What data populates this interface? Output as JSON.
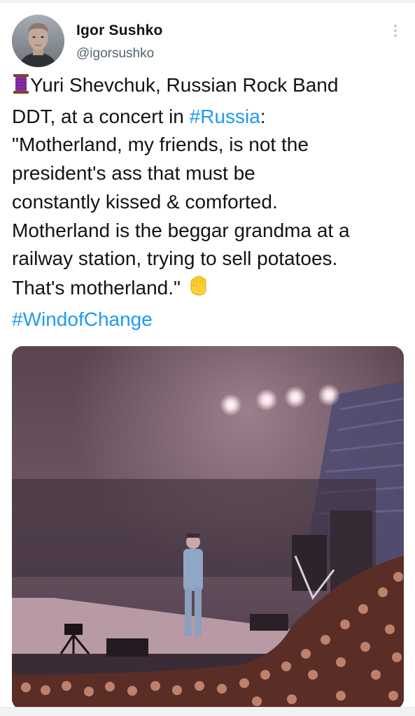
{
  "tweet": {
    "author": {
      "display_name": "Igor Sushko",
      "handle": "@igorsushko",
      "avatar_icon": "profile-photo"
    },
    "more_icon": "more-vertical-icon",
    "text_lines": [
      {
        "pre": "Yuri Shevchuk, Russian Rock Band",
        "emoji": "thread-spool"
      },
      {
        "pre": "DDT, at a concert in ",
        "hashtag": "#Russia",
        "post": ":"
      },
      {
        "pre": "\"Motherland, my friends, is not the"
      },
      {
        "pre": "president's ass that must be"
      },
      {
        "pre": "constantly kissed & comforted."
      },
      {
        "pre": "Motherland is the beggar grandma at a"
      },
      {
        "pre": "railway station, trying to sell potatoes."
      },
      {
        "pre": "That's motherland.\" ",
        "emoji": "raised-fist"
      },
      {
        "hashtag": "#WindofChange"
      }
    ],
    "media": {
      "type": "video-still",
      "subject": "concert-stage-with-crowd"
    },
    "colors": {
      "hashtag": "#1d9bf0",
      "text": "#0f1419",
      "secondary": "#536471"
    }
  }
}
